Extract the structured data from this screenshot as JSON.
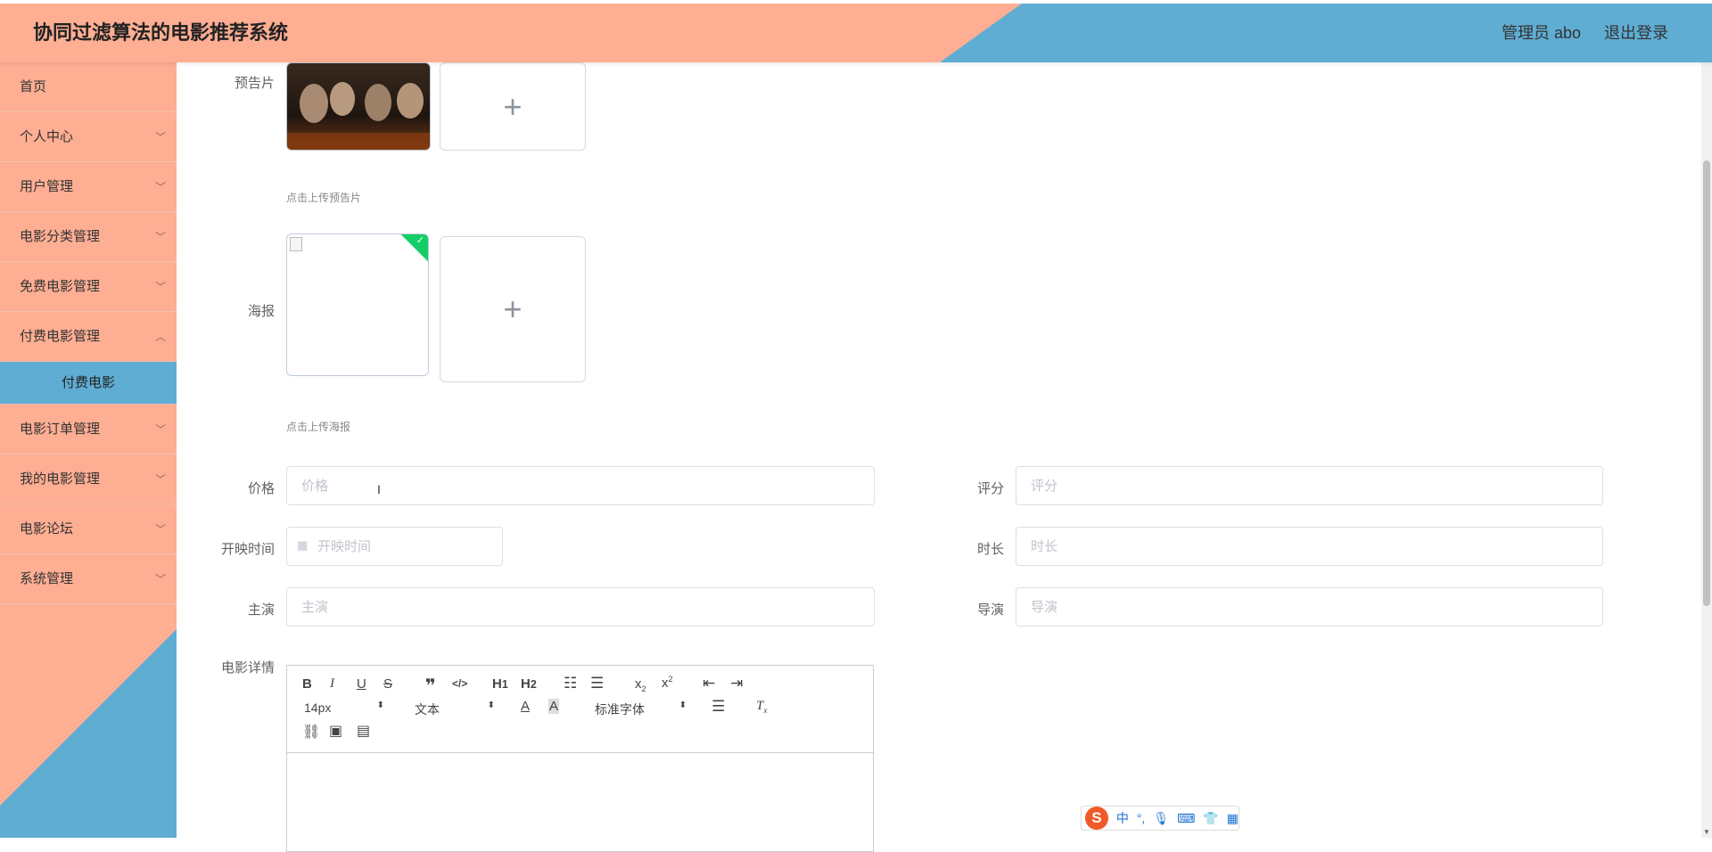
{
  "header": {
    "title": "协同过滤算法的电影推荐系统",
    "user": "管理员 abo",
    "logout": "退出登录"
  },
  "sidebar": {
    "items": [
      {
        "label": "首页"
      },
      {
        "label": "个人中心"
      },
      {
        "label": "用户管理"
      },
      {
        "label": "电影分类管理"
      },
      {
        "label": "免费电影管理"
      },
      {
        "label": "付费电影管理"
      },
      {
        "label": "付费电影"
      },
      {
        "label": "电影订单管理"
      },
      {
        "label": "我的电影管理"
      },
      {
        "label": "电影论坛"
      },
      {
        "label": "系统管理"
      }
    ]
  },
  "form": {
    "trailer_label": "预告片",
    "trailer_hint": "点击上传预告片",
    "poster_label": "海报",
    "poster_hint": "点击上传海报",
    "price_label": "价格",
    "price_placeholder": "价格",
    "rating_label": "评分",
    "rating_placeholder": "评分",
    "release_label": "开映时间",
    "release_placeholder": "开映时间",
    "duration_label": "时长",
    "duration_placeholder": "时长",
    "cast_label": "主演",
    "cast_placeholder": "主演",
    "director_label": "导演",
    "director_placeholder": "导演",
    "details_label": "电影详情"
  },
  "editor": {
    "size_value": "14px",
    "header_value": "文本",
    "font_value": "标准字体"
  },
  "ime": {
    "logo": "S",
    "mode": "中"
  },
  "colors": {
    "accent_salmon": "#fdae93",
    "accent_blue": "#5fadd3"
  }
}
